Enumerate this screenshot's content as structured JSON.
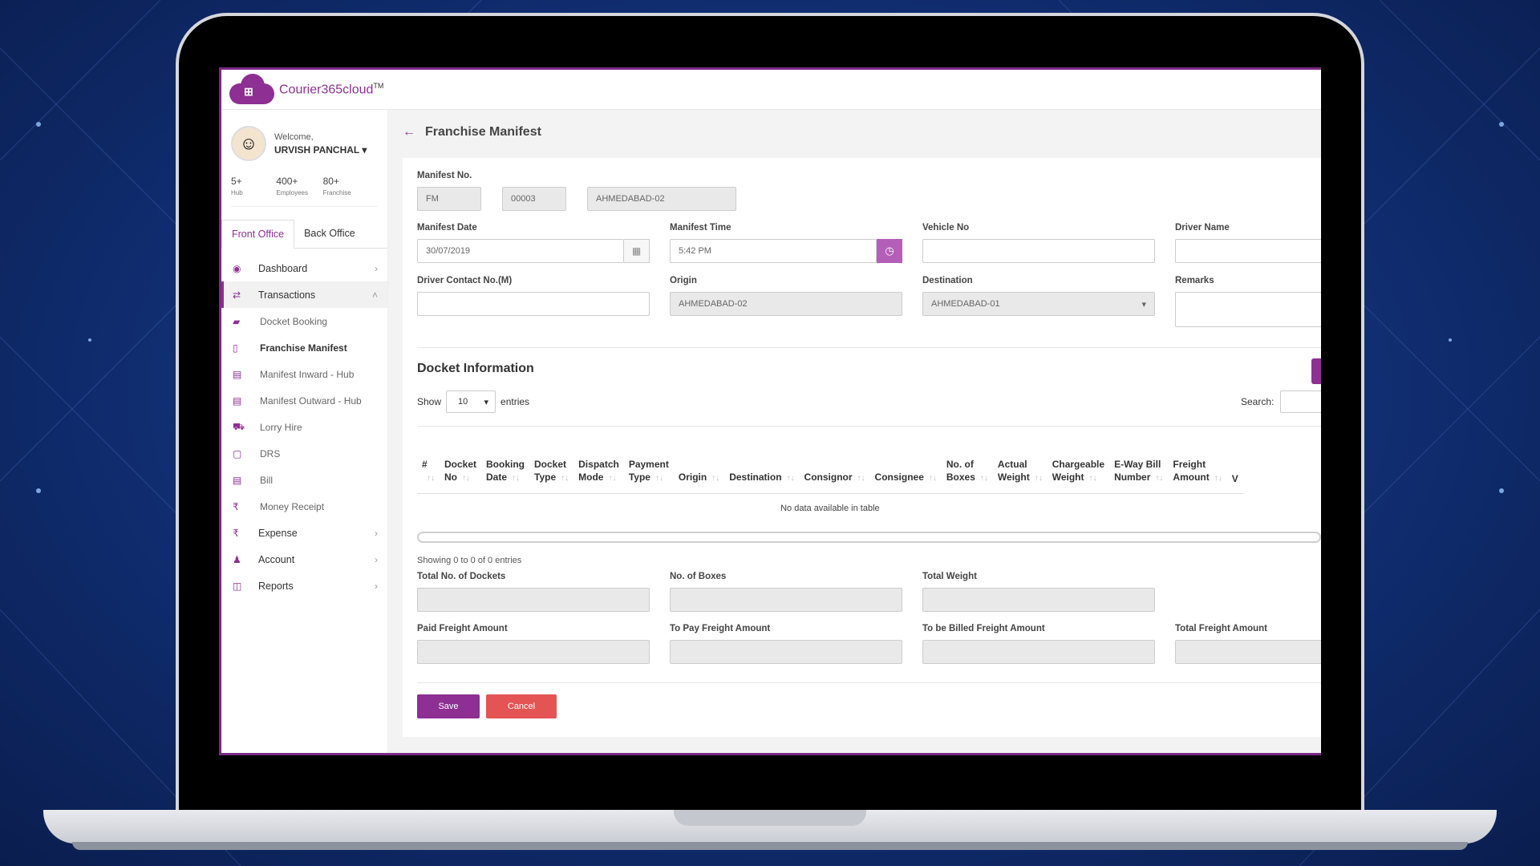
{
  "brand": {
    "name": "Courier365cloud",
    "tm": "TM"
  },
  "user": {
    "welcome": "Welcome,",
    "name": "URVISH PANCHAL"
  },
  "stats": [
    {
      "value": "5+",
      "label": "Hub"
    },
    {
      "value": "400+",
      "label": "Employees"
    },
    {
      "value": "80+",
      "label": "Franchise"
    }
  ],
  "tabs": [
    "Front Office",
    "Back Office"
  ],
  "menu": {
    "dashboard": "Dashboard",
    "transactions": "Transactions",
    "sub": [
      "Docket Booking",
      "Franchise Manifest",
      "Manifest Inward - Hub",
      "Manifest Outward - Hub",
      "Lorry Hire",
      "DRS",
      "Bill",
      "Money Receipt"
    ],
    "expense": "Expense",
    "account": "Account",
    "reports": "Reports"
  },
  "page": {
    "title": "Franchise Manifest"
  },
  "form": {
    "manifest_no_label": "Manifest No.",
    "manifest_prefix": "FM",
    "manifest_number": "00003",
    "manifest_branch": "AHMEDABAD-02",
    "manifest_date_label": "Manifest Date",
    "manifest_date": "30/07/2019",
    "manifest_time_label": "Manifest Time",
    "manifest_time": "5:42 PM",
    "vehicle_label": "Vehicle No",
    "driver_name_label": "Driver Name",
    "driver_contact_label": "Driver Contact No.(M)",
    "origin_label": "Origin",
    "origin": "AHMEDABAD-02",
    "destination_label": "Destination",
    "destination": "AHMEDABAD-01",
    "remarks_label": "Remarks"
  },
  "docket": {
    "title": "Docket Information",
    "show": "Show",
    "entries_value": "10",
    "entries": "entries",
    "search": "Search:",
    "columns": [
      [
        "#",
        ""
      ],
      [
        "Docket",
        "No"
      ],
      [
        "Booking",
        "Date"
      ],
      [
        "Docket",
        "Type"
      ],
      [
        "Dispatch",
        "Mode"
      ],
      [
        "Payment",
        "Type"
      ],
      [
        "",
        "Origin"
      ],
      [
        "",
        "Destination"
      ],
      [
        "",
        "Consignor"
      ],
      [
        "",
        "Consignee"
      ],
      [
        "No. of",
        "Boxes"
      ],
      [
        "Actual",
        "Weight"
      ],
      [
        "Chargeable",
        "Weight"
      ],
      [
        "E-Way Bill",
        "Number"
      ],
      [
        "Freight",
        "Amount"
      ],
      [
        "",
        "V"
      ]
    ],
    "empty": "No data available in table",
    "showing": "Showing 0 to 0 of 0 entries"
  },
  "totals": {
    "total_dockets": "Total No. of Dockets",
    "boxes": "No. of Boxes",
    "total_weight": "Total Weight",
    "paid": "Paid Freight Amount",
    "topay": "To Pay Freight Amount",
    "billed": "To be Billed Freight Amount",
    "total_freight": "Total Freight Amount"
  },
  "buttons": {
    "save": "Save",
    "cancel": "Cancel"
  }
}
